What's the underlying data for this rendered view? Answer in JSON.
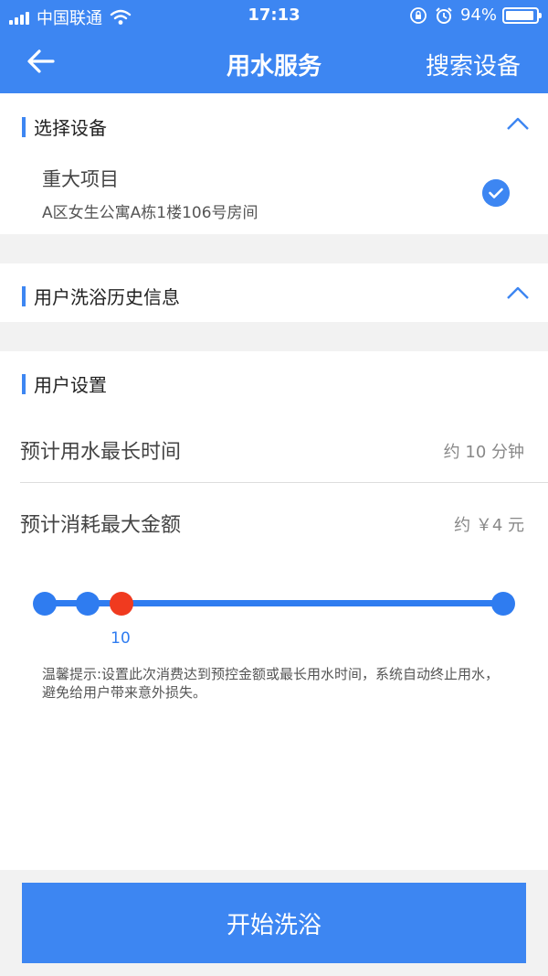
{
  "status_bar": {
    "carrier": "中国联通",
    "time": "17:13",
    "battery_percent": "94%",
    "battery_level": 0.94,
    "icons": [
      "signal-icon",
      "wifi-icon",
      "rotation-lock-icon",
      "alarm-icon",
      "battery-icon"
    ]
  },
  "nav": {
    "back_icon": "arrow-left-icon",
    "title": "用水服务",
    "right_action": "搜索设备"
  },
  "select_device": {
    "title": "选择设备",
    "toggle_icon": "chevron-up-icon",
    "device": {
      "name": "重大项目",
      "location": "A区女生公寓A栋1楼106号房间",
      "selected": true
    }
  },
  "history": {
    "title": "用户洗浴历史信息",
    "toggle_icon": "chevron-up-icon"
  },
  "user_settings": {
    "title": "用户设置",
    "rows": [
      {
        "label": "预计用水最长时间",
        "value": "约 10 分钟"
      },
      {
        "label": "预计消耗最大金额",
        "value": "约 ￥4 元"
      }
    ],
    "slider": {
      "stops": 4,
      "selected_index": 2,
      "selected_label": "10"
    },
    "tip": "温馨提示:设置此次消费达到预控金额或最长用水时间，系统自动终止用水，避免给用户带来意外损失。"
  },
  "start_button": "开始洗浴",
  "colors": {
    "primary": "#3d86f2",
    "slider_active": "#f03a1f",
    "background": "#f2f2f2"
  }
}
